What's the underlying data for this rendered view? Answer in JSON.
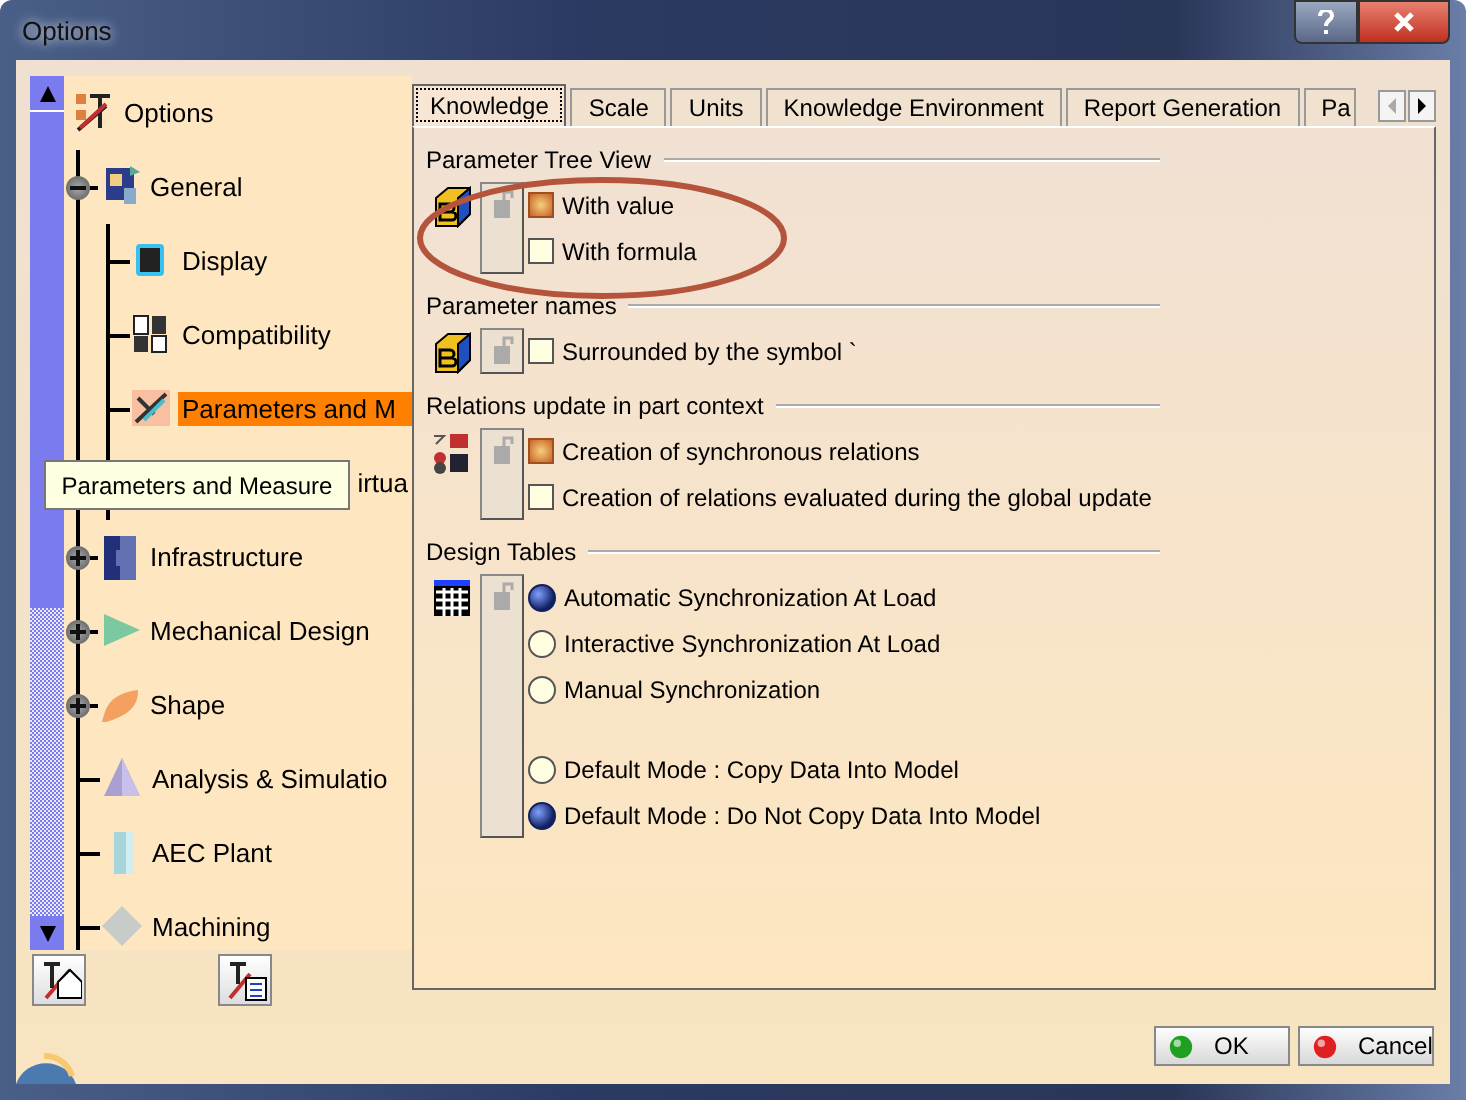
{
  "window": {
    "title": "Options"
  },
  "tree": {
    "label": "Options",
    "children": [
      {
        "label": "General",
        "expanded": true,
        "children": [
          {
            "label": "Display"
          },
          {
            "label": "Compatibility"
          },
          {
            "label": "Parameters and M",
            "selected": true
          },
          {
            "label": "irtua",
            "kind": "covered"
          }
        ]
      },
      {
        "label": "Infrastructure",
        "expanded": false
      },
      {
        "label": "Mechanical Design",
        "expanded": false
      },
      {
        "label": "Shape",
        "expanded": false
      },
      {
        "label": "Analysis & Simulatio"
      },
      {
        "label": "AEC Plant"
      },
      {
        "label": "Machining"
      }
    ]
  },
  "tooltip": "Parameters and Measure",
  "tabs": [
    {
      "label": "Knowledge",
      "selected": true
    },
    {
      "label": "Scale",
      "selected": false
    },
    {
      "label": "Units",
      "selected": false
    },
    {
      "label": "Knowledge Environment",
      "selected": false
    },
    {
      "label": "Report Generation",
      "selected": false
    },
    {
      "label": "Pa",
      "selected": false
    }
  ],
  "sections": [
    {
      "title": "Parameter Tree View",
      "kind": "checkbox",
      "groups": [
        [
          {
            "label": "With value",
            "checked": true
          },
          {
            "label": "With formula",
            "checked": false
          }
        ]
      ]
    },
    {
      "title": "Parameter names",
      "kind": "checkbox",
      "groups": [
        [
          {
            "label": "Surrounded by the symbol `",
            "checked": false
          }
        ]
      ]
    },
    {
      "title": "Relations update in part context",
      "kind": "checkbox",
      "groups": [
        [
          {
            "label": "Creation of synchronous relations",
            "checked": true
          },
          {
            "label": "Creation of relations evaluated during the global update",
            "checked": false
          }
        ]
      ]
    },
    {
      "title": "Design Tables",
      "kind": "radio",
      "groups": [
        [
          {
            "label": "Automatic Synchronization At Load",
            "selected": true
          },
          {
            "label": "Interactive Synchronization At Load",
            "selected": false
          },
          {
            "label": "Manual Synchronization",
            "selected": false
          }
        ],
        [
          {
            "label": "Default Mode : Copy Data Into Model",
            "selected": false
          },
          {
            "label": "Default Mode : Do Not Copy Data Into Model",
            "selected": true
          }
        ]
      ]
    }
  ],
  "buttons": [
    {
      "label": "OK",
      "kind": "ok"
    },
    {
      "label": "Cancel",
      "kind": "cancel"
    }
  ]
}
